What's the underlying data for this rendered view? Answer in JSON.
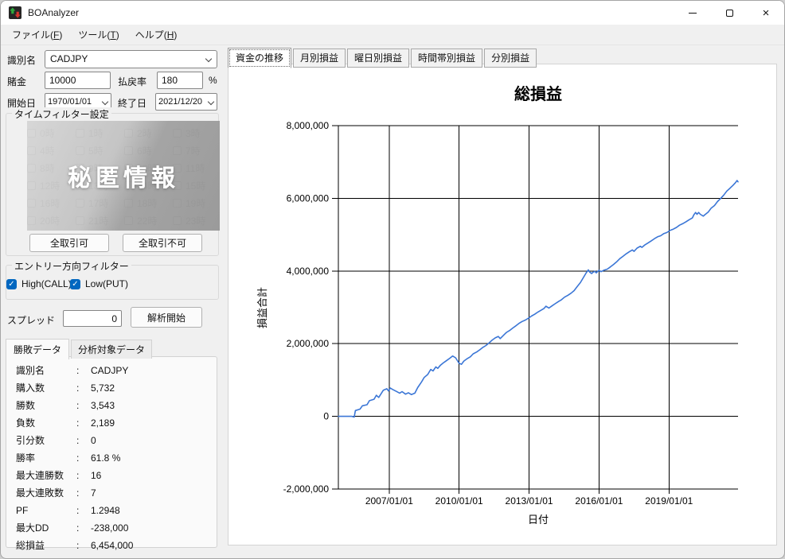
{
  "window": {
    "title": "BOAnalyzer"
  },
  "menu": {
    "items": [
      "ファイル(F)",
      "ツール(T)",
      "ヘルプ(H)"
    ]
  },
  "form": {
    "identifier_label": "識別名",
    "identifier_value": "CADJPY",
    "bet_label": "賭金",
    "bet_value": "10000",
    "payout_label": "払戻率",
    "payout_value": "180",
    "payout_unit": "%",
    "start_label": "開始日",
    "start_value": "1970/01/01",
    "end_label": "終了日",
    "end_value": "2021/12/20"
  },
  "time_filter": {
    "title": "タイムフィルター設定",
    "hours": [
      "0時",
      "1時",
      "2時",
      "3時",
      "4時",
      "5時",
      "6時",
      "7時",
      "8時",
      "9時",
      "10時",
      "11時",
      "12時",
      "13時",
      "14時",
      "15時",
      "16時",
      "17時",
      "18時",
      "19時",
      "20時",
      "21時",
      "22時",
      "23時"
    ],
    "overlay_text": "秘匿情報",
    "enable_all_label": "全取引可",
    "disable_all_label": "全取引不可"
  },
  "entry_filter": {
    "title": "エントリー方向フィルター",
    "options": [
      {
        "label": "High(CALL)",
        "checked": true
      },
      {
        "label": "Low(PUT)",
        "checked": true
      }
    ]
  },
  "spread": {
    "label": "スプレッド",
    "value": "0",
    "analyze_button": "解析開始"
  },
  "stats": {
    "tabs": [
      "勝敗データ",
      "分析対象データ"
    ],
    "active_tab": 0,
    "separator": ":",
    "rows": [
      {
        "label": "識別名",
        "value": "CADJPY"
      },
      {
        "label": "購入数",
        "value": "5,732"
      },
      {
        "label": "勝数",
        "value": "3,543"
      },
      {
        "label": "負数",
        "value": "2,189"
      },
      {
        "label": "引分数",
        "value": "0"
      },
      {
        "label": "勝率",
        "value": "61.8 %"
      },
      {
        "label": "最大連勝数",
        "value": "16"
      },
      {
        "label": "最大連敗数",
        "value": "7"
      },
      {
        "label": "PF",
        "value": "1.2948"
      },
      {
        "label": "最大DD",
        "value": "-238,000"
      },
      {
        "label": "総損益",
        "value": "6,454,000"
      }
    ]
  },
  "chart": {
    "tabs": [
      "資金の推移",
      "月別損益",
      "曜日別損益",
      "時間帯別損益",
      "分別損益"
    ],
    "active_tab": 0
  },
  "chart_data": {
    "type": "line",
    "title": "総損益",
    "xlabel": "日付",
    "ylabel": "損益合計",
    "x_ticks": [
      "2007/01/01",
      "2010/01/01",
      "2013/01/01",
      "2016/01/01",
      "2019/01/01"
    ],
    "x_tick_years": [
      2007,
      2010,
      2013,
      2016,
      2019
    ],
    "x_range": [
      2004.82,
      2021.96
    ],
    "ylim": [
      -2000000,
      8000000
    ],
    "y_ticks": [
      "8,000,000",
      "6,000,000",
      "4,000,000",
      "2,000,000",
      "0",
      "-2,000,000"
    ],
    "y_tick_values": [
      8000000,
      6000000,
      4000000,
      2000000,
      0,
      -2000000
    ],
    "grid": true,
    "legend": "none",
    "line_color": "#3b76d6",
    "series": [
      {
        "name": "損益合計",
        "points": [
          [
            2004.82,
            0
          ],
          [
            2005.4,
            0
          ],
          [
            2005.5,
            -20000
          ],
          [
            2005.55,
            160000
          ],
          [
            2005.75,
            200000
          ],
          [
            2005.85,
            290000
          ],
          [
            2006.05,
            320000
          ],
          [
            2006.15,
            430000
          ],
          [
            2006.35,
            470000
          ],
          [
            2006.45,
            580000
          ],
          [
            2006.55,
            520000
          ],
          [
            2006.75,
            720000
          ],
          [
            2006.9,
            760000
          ],
          [
            2006.97,
            700000
          ],
          [
            2007.05,
            780000
          ],
          [
            2007.15,
            740000
          ],
          [
            2007.3,
            690000
          ],
          [
            2007.45,
            640000
          ],
          [
            2007.55,
            680000
          ],
          [
            2007.7,
            610000
          ],
          [
            2007.82,
            650000
          ],
          [
            2007.95,
            600000
          ],
          [
            2008.1,
            640000
          ],
          [
            2008.22,
            790000
          ],
          [
            2008.38,
            940000
          ],
          [
            2008.5,
            1070000
          ],
          [
            2008.65,
            1150000
          ],
          [
            2008.78,
            1290000
          ],
          [
            2008.88,
            1250000
          ],
          [
            2009.0,
            1360000
          ],
          [
            2009.08,
            1320000
          ],
          [
            2009.2,
            1410000
          ],
          [
            2009.32,
            1470000
          ],
          [
            2009.45,
            1530000
          ],
          [
            2009.6,
            1600000
          ],
          [
            2009.72,
            1660000
          ],
          [
            2009.85,
            1610000
          ],
          [
            2010.0,
            1460000
          ],
          [
            2010.1,
            1430000
          ],
          [
            2010.2,
            1520000
          ],
          [
            2010.35,
            1590000
          ],
          [
            2010.48,
            1640000
          ],
          [
            2010.6,
            1720000
          ],
          [
            2010.75,
            1770000
          ],
          [
            2010.88,
            1830000
          ],
          [
            2011.0,
            1890000
          ],
          [
            2011.15,
            1950000
          ],
          [
            2011.28,
            2020000
          ],
          [
            2011.42,
            2100000
          ],
          [
            2011.55,
            2160000
          ],
          [
            2011.68,
            2200000
          ],
          [
            2011.76,
            2140000
          ],
          [
            2011.9,
            2230000
          ],
          [
            2012.03,
            2310000
          ],
          [
            2012.16,
            2360000
          ],
          [
            2012.3,
            2430000
          ],
          [
            2012.43,
            2490000
          ],
          [
            2012.57,
            2560000
          ],
          [
            2012.7,
            2610000
          ],
          [
            2012.84,
            2650000
          ],
          [
            2012.97,
            2700000
          ],
          [
            2013.1,
            2760000
          ],
          [
            2013.24,
            2810000
          ],
          [
            2013.38,
            2870000
          ],
          [
            2013.51,
            2920000
          ],
          [
            2013.64,
            2970000
          ],
          [
            2013.72,
            3030000
          ],
          [
            2013.85,
            2980000
          ],
          [
            2013.98,
            3040000
          ],
          [
            2014.12,
            3100000
          ],
          [
            2014.26,
            3160000
          ],
          [
            2014.39,
            3210000
          ],
          [
            2014.52,
            3280000
          ],
          [
            2014.66,
            3330000
          ],
          [
            2014.8,
            3390000
          ],
          [
            2014.93,
            3460000
          ],
          [
            2015.06,
            3570000
          ],
          [
            2015.2,
            3680000
          ],
          [
            2015.33,
            3820000
          ],
          [
            2015.46,
            3960000
          ],
          [
            2015.54,
            4030000
          ],
          [
            2015.6,
            3970000
          ],
          [
            2015.68,
            3930000
          ],
          [
            2015.75,
            3970000
          ],
          [
            2015.82,
            3990000
          ],
          [
            2015.88,
            3950000
          ],
          [
            2016.0,
            4020000
          ],
          [
            2016.08,
            3980000
          ],
          [
            2016.2,
            4020000
          ],
          [
            2016.35,
            4050000
          ],
          [
            2016.48,
            4110000
          ],
          [
            2016.62,
            4180000
          ],
          [
            2016.75,
            4250000
          ],
          [
            2016.89,
            4340000
          ],
          [
            2017.02,
            4400000
          ],
          [
            2017.16,
            4470000
          ],
          [
            2017.3,
            4530000
          ],
          [
            2017.43,
            4580000
          ],
          [
            2017.5,
            4540000
          ],
          [
            2017.63,
            4630000
          ],
          [
            2017.77,
            4680000
          ],
          [
            2017.84,
            4650000
          ],
          [
            2017.97,
            4720000
          ],
          [
            2018.1,
            4770000
          ],
          [
            2018.24,
            4830000
          ],
          [
            2018.38,
            4890000
          ],
          [
            2018.51,
            4940000
          ],
          [
            2018.64,
            4970000
          ],
          [
            2018.78,
            5030000
          ],
          [
            2018.91,
            5060000
          ],
          [
            2019.05,
            5120000
          ],
          [
            2019.18,
            5150000
          ],
          [
            2019.32,
            5200000
          ],
          [
            2019.45,
            5260000
          ],
          [
            2019.58,
            5300000
          ],
          [
            2019.72,
            5350000
          ],
          [
            2019.86,
            5410000
          ],
          [
            2020.0,
            5460000
          ],
          [
            2020.07,
            5550000
          ],
          [
            2020.14,
            5610000
          ],
          [
            2020.2,
            5560000
          ],
          [
            2020.27,
            5610000
          ],
          [
            2020.34,
            5560000
          ],
          [
            2020.47,
            5510000
          ],
          [
            2020.54,
            5550000
          ],
          [
            2020.68,
            5620000
          ],
          [
            2020.81,
            5730000
          ],
          [
            2020.95,
            5800000
          ],
          [
            2021.08,
            5910000
          ],
          [
            2021.22,
            6000000
          ],
          [
            2021.35,
            6090000
          ],
          [
            2021.48,
            6200000
          ],
          [
            2021.62,
            6280000
          ],
          [
            2021.75,
            6360000
          ],
          [
            2021.85,
            6430000
          ],
          [
            2021.92,
            6490000
          ],
          [
            2021.96,
            6454000
          ]
        ]
      }
    ]
  }
}
